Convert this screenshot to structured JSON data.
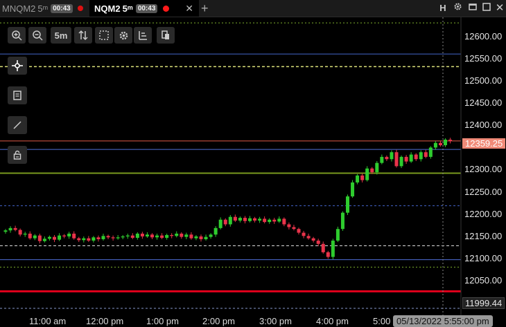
{
  "tabs": [
    {
      "symbol": "MNQM2",
      "interval": "5",
      "interval_unit": "m",
      "timer": "00:43",
      "active": false
    },
    {
      "symbol": "NQM2",
      "interval": "5",
      "interval_unit": "m",
      "timer": "00:43",
      "active": true,
      "close": "✕"
    }
  ],
  "window_buttons": {
    "h": "H"
  },
  "toolbar": {
    "interval_label": "5m"
  },
  "price_axis": {
    "labels": [
      "12600.00",
      "12550.00",
      "12500.00",
      "12450.00",
      "12400.00",
      "12350.00",
      "12300.00",
      "12250.00",
      "12200.00",
      "12150.00",
      "12100.00",
      "12050.00"
    ],
    "current_price": "12359.25",
    "low_label": "11999.44"
  },
  "time_axis": {
    "labels": [
      "11:00 am",
      "12:00 pm",
      "1:00 pm",
      "2:00 pm",
      "3:00 pm",
      "4:00 pm",
      "5:00"
    ],
    "crosshair_datetime": "05/13/2022 5:55:00 pm"
  },
  "colors": {
    "up": "#2ecc2e",
    "down": "#e8334a",
    "current_price_bg": "#f08a78",
    "support_red": "#e3001b"
  },
  "chart_data": {
    "type": "candlestick",
    "ylim": [
      11995,
      12625
    ],
    "horizontal_lines": [
      12613,
      12546,
      12519,
      12359.25,
      12341,
      12290,
      12220,
      12134,
      12104,
      12088,
      12036,
      11999.44
    ],
    "closes": [
      12167,
      12172,
      12168,
      12158,
      12160,
      12150,
      12156,
      12144,
      12149,
      12153,
      12147,
      12156,
      12154,
      12160,
      12150,
      12146,
      12150,
      12145,
      12152,
      12148,
      12155,
      12152,
      12150,
      12152,
      12154,
      12156,
      12151,
      12160,
      12154,
      12158,
      12152,
      12156,
      12151,
      12157,
      12155,
      12160,
      12153,
      12158,
      12150,
      12154,
      12148,
      12153,
      12158,
      12172,
      12190,
      12180,
      12196,
      12188,
      12194,
      12187,
      12193,
      12188,
      12192,
      12185,
      12190,
      12186,
      12192,
      12180,
      12174,
      12170,
      12162,
      12155,
      12150,
      12145,
      12138,
      12120,
      12110,
      12145,
      12170,
      12205,
      12240,
      12270,
      12285,
      12275,
      12300,
      12292,
      12312,
      12325,
      12320,
      12335,
      12305,
      12325,
      12315,
      12330,
      12320,
      12335,
      12325,
      12345,
      12355,
      12350,
      12362,
      12359
    ]
  }
}
